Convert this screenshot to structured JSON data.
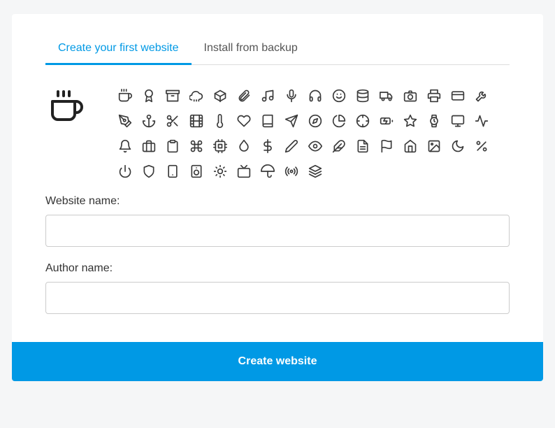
{
  "tabs": {
    "create": "Create your first website",
    "backup": "Install from backup"
  },
  "selected_icon": "coffee",
  "icons": [
    "coffee",
    "award",
    "archive",
    "cloud-rain",
    "package",
    "paperclip",
    "music",
    "mic",
    "headphones",
    "smile",
    "database",
    "truck",
    "camera",
    "printer",
    "credit-card",
    "tool",
    "pen-tool",
    "anchor",
    "scissors",
    "film",
    "thermometer",
    "heart",
    "book",
    "send",
    "compass",
    "pie-chart",
    "crosshair",
    "battery-charging",
    "star",
    "watch",
    "monitor",
    "activity",
    "bell",
    "briefcase",
    "clipboard",
    "command",
    "cpu",
    "droplet",
    "dollar-sign",
    "edit",
    "eye",
    "feather",
    "file-text",
    "flag",
    "home",
    "image",
    "moon",
    "percent",
    "power",
    "shield",
    "smartphone",
    "speaker",
    "sun",
    "tv",
    "umbrella",
    "radio",
    "layers"
  ],
  "form": {
    "website_label": "Website name:",
    "author_label": "Author name:"
  },
  "submit_label": "Create website"
}
